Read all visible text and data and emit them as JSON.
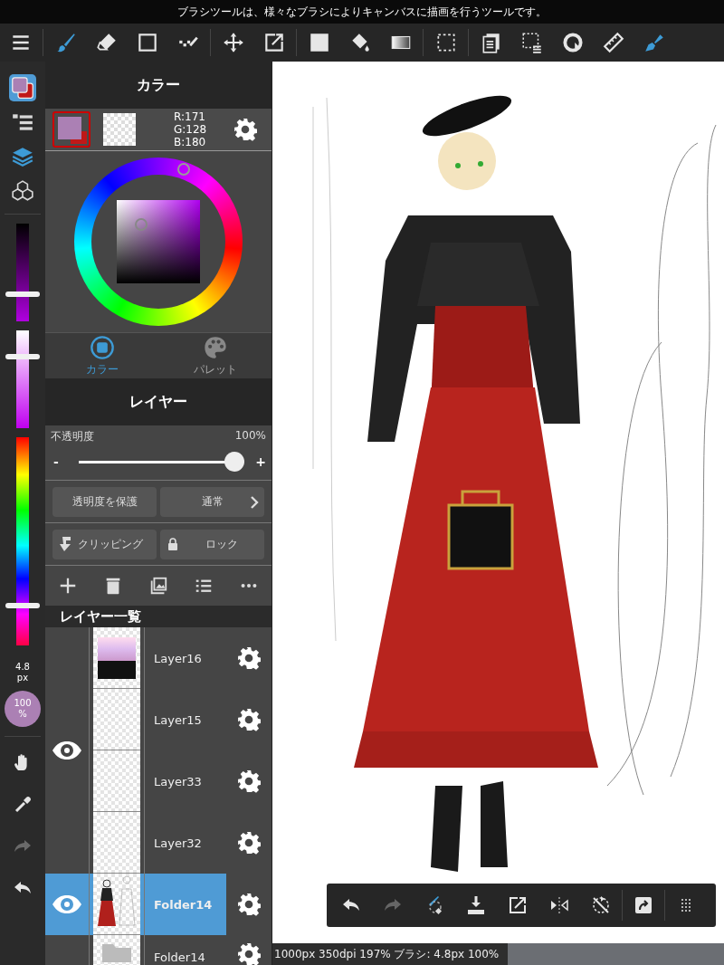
{
  "hint": "ブラシツールは、様々なブラシによりキャンバスに描画を行うツールです。",
  "toolbar": [
    {
      "tools": [
        {
          "kind": "menu",
          "selected": false
        }
      ]
    },
    {
      "tools": [
        {
          "kind": "brush",
          "selected": true
        },
        {
          "kind": "eraser",
          "selected": false
        },
        {
          "kind": "rect",
          "selected": false
        },
        {
          "kind": "dots",
          "selected": false
        }
      ]
    },
    {
      "tools": [
        {
          "kind": "move",
          "selected": false
        },
        {
          "kind": "transform",
          "selected": false
        }
      ]
    },
    {
      "tools": [
        {
          "kind": "fill",
          "selected": false
        },
        {
          "kind": "bucket",
          "selected": false
        },
        {
          "kind": "gradient",
          "selected": false
        }
      ]
    },
    {
      "tools": [
        {
          "kind": "select",
          "selected": false
        }
      ]
    },
    {
      "tools": [
        {
          "kind": "copy",
          "selected": false
        },
        {
          "kind": "selectlist",
          "selected": false
        },
        {
          "kind": "rotate",
          "selected": false
        },
        {
          "kind": "ruler",
          "selected": false
        },
        {
          "kind": "pen",
          "selected": true
        }
      ]
    }
  ],
  "sidebar": {
    "tabs": [
      {
        "kind": "color",
        "selected": true
      },
      {
        "kind": "tree",
        "selected": false
      },
      {
        "kind": "layers",
        "selected": true
      },
      {
        "kind": "material",
        "selected": false
      }
    ],
    "sliders": [
      {
        "kind": "shade",
        "level": 0.29
      },
      {
        "kind": "tint",
        "level": 0.72
      },
      {
        "kind": "hue",
        "level": 0.2
      }
    ],
    "brush_size": "4.8",
    "brush_unit": "px",
    "opacity": "100",
    "opacity_unit": "%",
    "tools": [
      {
        "kind": "hand",
        "disabled": false
      },
      {
        "kind": "eyedropper",
        "disabled": false
      },
      {
        "kind": "redo",
        "disabled": true
      },
      {
        "kind": "undo",
        "disabled": false
      }
    ]
  },
  "color_panel": {
    "title": "カラー",
    "rgb": [
      "R:171",
      "G:128",
      "B:180"
    ],
    "tabs": [
      {
        "label": "カラー",
        "kind": "color",
        "selected": true
      },
      {
        "label": "パレット",
        "kind": "palette",
        "selected": false
      }
    ]
  },
  "layer_panel": {
    "title": "レイヤー",
    "opacity_label": "不透明度",
    "opacity_value": "100%",
    "opacity_slider": {
      "level": 1.0
    },
    "minus": "-",
    "plus": "+",
    "protect_button": "透明度を保護",
    "blend_button": "通常",
    "clipping_button": "クリッピング",
    "lock_button": "ロック",
    "actions": [
      {
        "kind": "add"
      },
      {
        "kind": "trash"
      },
      {
        "kind": "image"
      },
      {
        "kind": "list"
      },
      {
        "kind": "more"
      }
    ],
    "list_title": "レイヤー一覧",
    "groups": [
      {
        "visible": true,
        "layers": [
          {
            "name": "Layer16",
            "kind": "chart",
            "selected": false
          },
          {
            "name": "Layer15",
            "kind": "blank",
            "selected": false
          },
          {
            "name": "Layer33",
            "kind": "blank",
            "selected": false
          },
          {
            "name": "Layer32",
            "kind": "blank",
            "selected": false
          }
        ]
      },
      {
        "visible": true,
        "layers": [
          {
            "name": "Folder14",
            "kind": "figure",
            "selected": true
          }
        ]
      },
      {
        "visible": false,
        "layers": [
          {
            "name": "Folder14",
            "kind": "folder",
            "selected": false
          }
        ]
      }
    ]
  },
  "quick_bar": [
    {
      "kind": "undo",
      "disabled": false
    },
    {
      "kind": "redo",
      "disabled": true
    },
    {
      "kind": "brushtoggle",
      "disabled": false
    },
    {
      "kind": "download",
      "disabled": false
    },
    {
      "kind": "export",
      "disabled": false
    },
    {
      "kind": "flip",
      "disabled": false
    },
    {
      "kind": "rotateoff",
      "disabled": false
    },
    {
      "kind": "share",
      "disabled": false
    },
    {
      "kind": "grid",
      "disabled": false
    }
  ],
  "status": "1000px 350dpi 197% ブラシ: 4.8px 100%"
}
